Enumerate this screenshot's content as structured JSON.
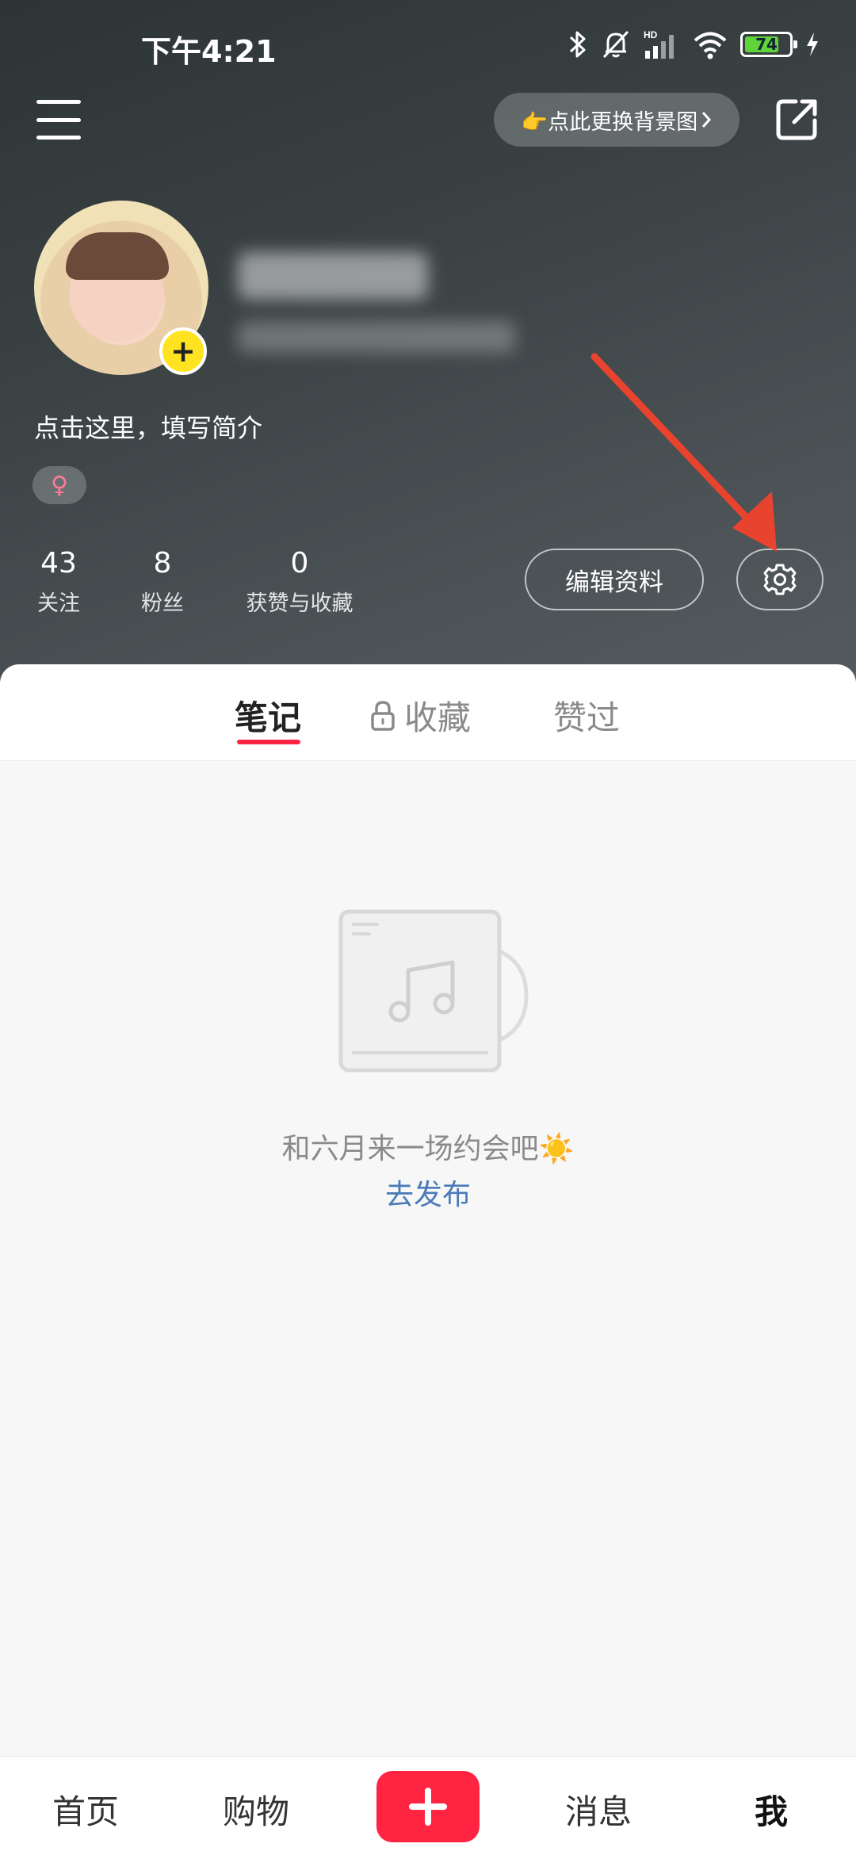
{
  "status_bar": {
    "time": "下午4:21",
    "battery": "74",
    "icons": [
      "bluetooth-icon",
      "mute-bell-icon",
      "hd-signal-icon",
      "wifi-icon",
      "battery-icon",
      "charging-icon"
    ]
  },
  "header": {
    "bg_change_label": "👉点此更换背景图",
    "bio": "点击这里，填写简介",
    "gender": "♀",
    "accent_gender_color": "#ff7a9a"
  },
  "stats": [
    {
      "value": "43",
      "label": "关注"
    },
    {
      "value": "8",
      "label": "粉丝"
    },
    {
      "value": "0",
      "label": "获赞与收藏"
    }
  ],
  "actions": {
    "edit_label": "编辑资料"
  },
  "tabs": [
    {
      "label": "笔记",
      "active": true
    },
    {
      "label": "收藏",
      "active": false,
      "locked": true
    },
    {
      "label": "赞过",
      "active": false
    }
  ],
  "empty_state": {
    "message": "和六月来一场约会吧☀️",
    "action": "去发布"
  },
  "bottom_nav": [
    {
      "label": "首页"
    },
    {
      "label": "购物"
    },
    {
      "label": "消息"
    },
    {
      "label": "我",
      "active": true
    }
  ],
  "colors": {
    "brand_red": "#ff2442",
    "link_blue": "#4a7bb7",
    "avatar_badge": "#ffe321"
  }
}
